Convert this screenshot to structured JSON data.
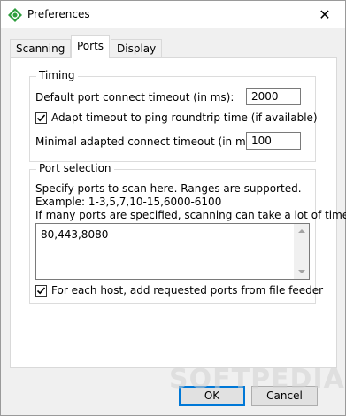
{
  "window": {
    "title": "Preferences",
    "close_symbol": "✕"
  },
  "tabs": [
    {
      "label": "Scanning",
      "active": false
    },
    {
      "label": "Ports",
      "active": true
    },
    {
      "label": "Display",
      "active": false
    }
  ],
  "timing": {
    "title": "Timing",
    "default_timeout_label": "Default port connect timeout (in ms):",
    "default_timeout_value": "2000",
    "adapt_label": "Adapt timeout to ping roundtrip time (if available)",
    "adapt_checked": true,
    "minimal_timeout_label": "Minimal adapted connect timeout (in ms):",
    "minimal_timeout_value": "100"
  },
  "port_selection": {
    "title": "Port selection",
    "help_line1": "Specify ports to scan here. Ranges are supported.",
    "help_line2": "Example: 1-3,5,7,10-15,6000-6100",
    "help_line3": "If many ports are specified, scanning can take a lot of time.",
    "ports_value": "80,443,8080",
    "feeder_label": "For each host, add requested ports from file feeder",
    "feeder_checked": true
  },
  "buttons": {
    "ok": "OK",
    "cancel": "Cancel"
  },
  "watermark": "SOFTPEDIA",
  "colors": {
    "accent": "#0078d7",
    "icon_green": "#2e9e3e"
  }
}
